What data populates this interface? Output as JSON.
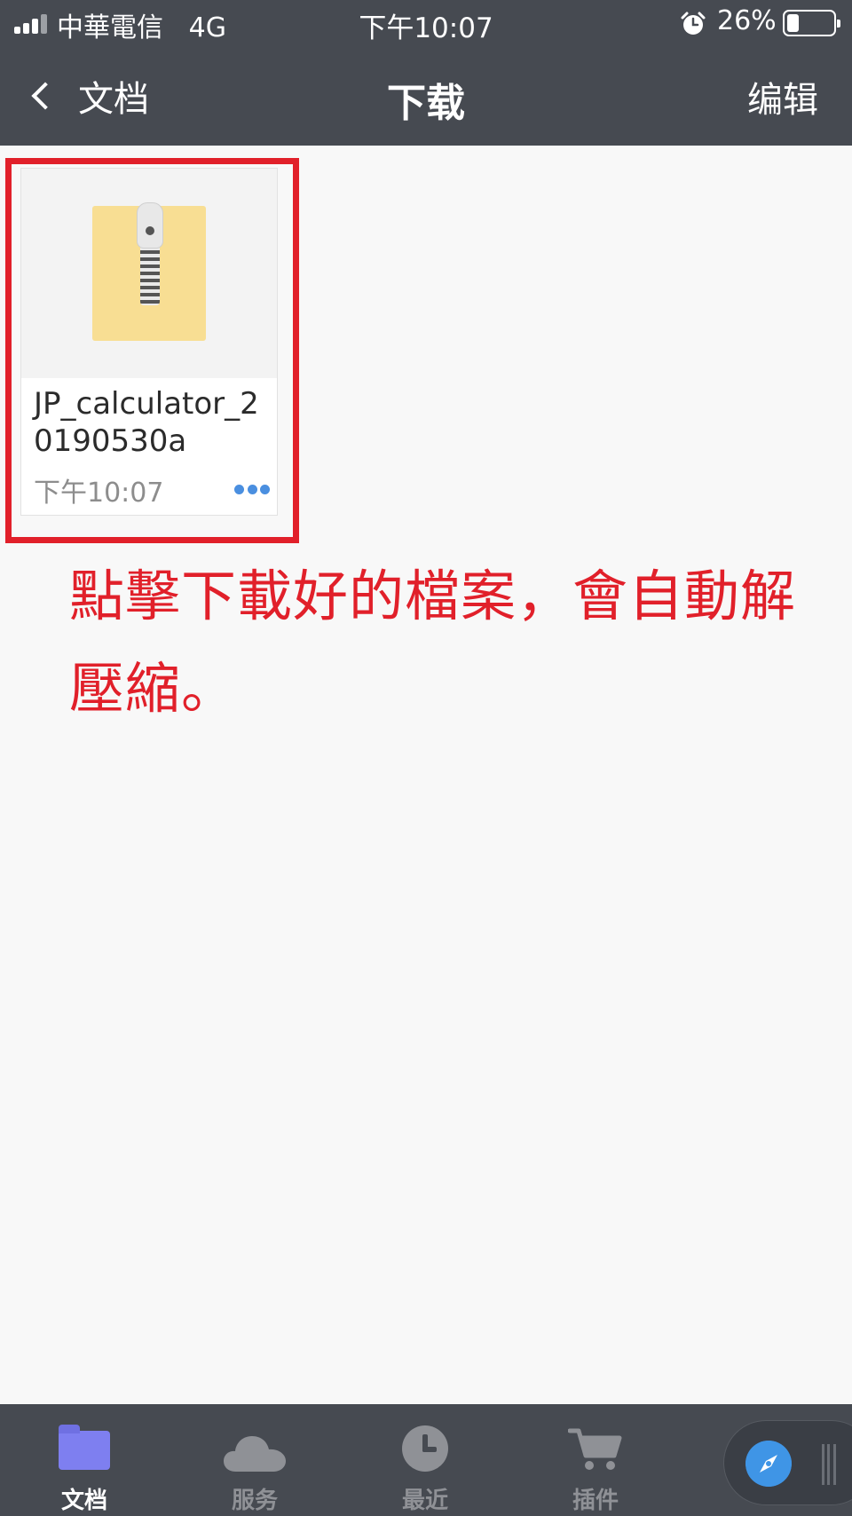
{
  "status_bar": {
    "carrier": "中華電信",
    "network": "4G",
    "time": "下午10:07",
    "battery_percent": "26%",
    "battery_level": 0.26
  },
  "nav": {
    "back_label": "文档",
    "title": "下载",
    "edit_label": "编辑"
  },
  "file": {
    "name": "JP_calculator_20190530a",
    "time": "下午10:07",
    "icon": "zip-archive-icon"
  },
  "annotation": {
    "text": "點擊下載好的檔案，會自動解壓縮。",
    "color": "#e1202a"
  },
  "tabs": [
    {
      "label": "文档",
      "icon": "folder-icon",
      "active": true
    },
    {
      "label": "服务",
      "icon": "cloud-icon",
      "active": false
    },
    {
      "label": "最近",
      "icon": "clock-icon",
      "active": false
    },
    {
      "label": "插件",
      "icon": "cart-icon",
      "active": false
    }
  ],
  "colors": {
    "bar_background": "#464a51",
    "accent_blue": "#4a8fe0",
    "highlight_red": "#e1202a",
    "folder_purple": "#7e7ff0"
  }
}
